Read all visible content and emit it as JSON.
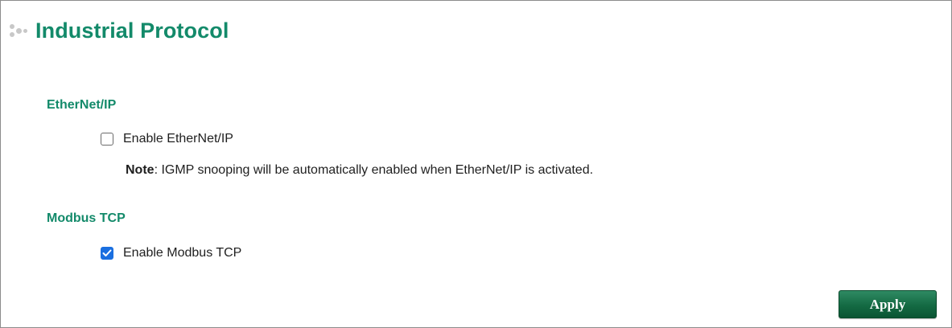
{
  "header": {
    "title": "Industrial Protocol",
    "icon": "dots-icon"
  },
  "ethernet_ip": {
    "section_title": "EtherNet/IP",
    "enable_label": "Enable EtherNet/IP",
    "enabled": false,
    "note_label": "Note",
    "note_text": ": IGMP snooping will be automatically enabled when EtherNet/IP is activated."
  },
  "modbus_tcp": {
    "section_title": "Modbus TCP",
    "enable_label": "Enable Modbus TCP",
    "enabled": true
  },
  "actions": {
    "apply_label": "Apply"
  },
  "colors": {
    "accent": "#138a6a",
    "button": "#146a43",
    "checkbox_checked": "#1a6fe0"
  }
}
